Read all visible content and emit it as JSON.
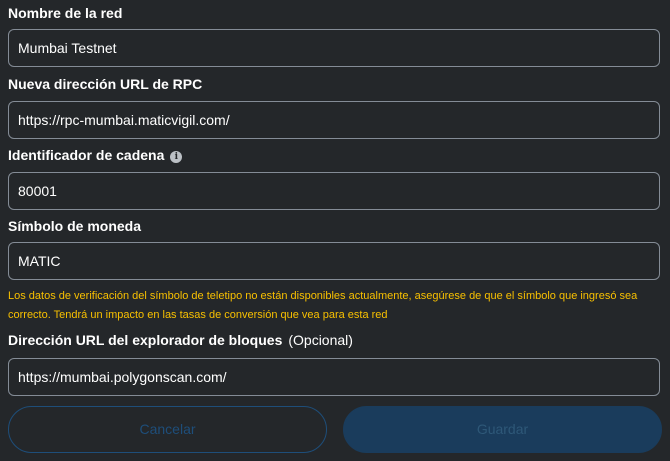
{
  "network_name": {
    "label": "Nombre de la red",
    "value": "Mumbai Testnet"
  },
  "rpc_url": {
    "label": "Nueva dirección URL de RPC",
    "value": "https://rpc-mumbai.maticvigil.com/"
  },
  "chain_id": {
    "label": "Identificador de cadena",
    "info_icon": "i",
    "value": "80001"
  },
  "currency_symbol": {
    "label": "Símbolo de moneda",
    "value": "MATIC",
    "warning": "Los datos de verificación del símbolo de teletipo no están disponibles actualmente, asegúrese de que el símbolo que ingresó sea correcto. Tendrá un impacto en las tasas de conversión que vea para esta red"
  },
  "block_explorer": {
    "label": "Dirección URL del explorador de bloques",
    "optional": "(Opcional)",
    "value": "https://mumbai.polygonscan.com/"
  },
  "buttons": {
    "cancel": "Cancelar",
    "save": "Guardar"
  },
  "colors": {
    "background": "#24272a",
    "warning": "#f8c000",
    "primary_disabled": "#1a3c5c",
    "border": "#848c96"
  }
}
